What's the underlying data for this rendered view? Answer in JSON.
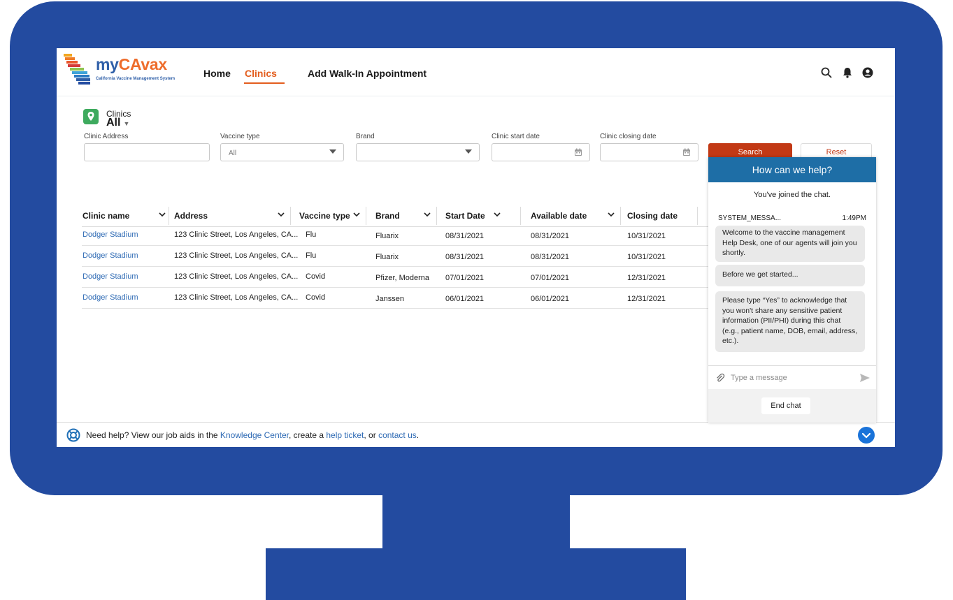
{
  "app": {
    "brand_prefix": "my",
    "brand_accent": "CAvax",
    "brand_subtitle": "California Vaccine Management System"
  },
  "nav": {
    "items": [
      {
        "label": "Home"
      },
      {
        "label": "Clinics",
        "active": true
      },
      {
        "label": "Add Walk-In Appointment"
      }
    ],
    "icons": [
      "search-icon",
      "bell-icon",
      "user-icon"
    ]
  },
  "page": {
    "object_label": "Clinics",
    "list_view": "All"
  },
  "filters": {
    "clinic_address": {
      "label": "Clinic Address",
      "value": ""
    },
    "vaccine_type": {
      "label": "Vaccine type",
      "value": "All"
    },
    "brand": {
      "label": "Brand",
      "value": ""
    },
    "start_date": {
      "label": "Clinic start date",
      "value": ""
    },
    "closing_date": {
      "label": "Clinic closing date",
      "value": ""
    },
    "search_label": "Search",
    "reset_label": "Reset"
  },
  "table": {
    "columns": [
      "Clinic name",
      "Address",
      "Vaccine type",
      "Brand",
      "Start Date",
      "Available date",
      "Closing date"
    ],
    "rows": [
      {
        "name": "Dodger Stadium",
        "address": "123 Clinic Street, Los Angeles, CA...",
        "vaccine": "Flu",
        "brand": "Fluarix",
        "start": "08/31/2021",
        "available": "08/31/2021",
        "closing": "10/31/2021"
      },
      {
        "name": "Dodger Stadium",
        "address": "123 Clinic Street, Los Angeles, CA...",
        "vaccine": "Flu",
        "brand": "Fluarix",
        "start": "08/31/2021",
        "available": "08/31/2021",
        "closing": "10/31/2021"
      },
      {
        "name": "Dodger Stadium",
        "address": "123 Clinic Street, Los Angeles, CA...",
        "vaccine": "Covid",
        "brand": "Pfizer, Moderna",
        "start": "07/01/2021",
        "available": "07/01/2021",
        "closing": "12/31/2021"
      },
      {
        "name": "Dodger Stadium",
        "address": "123 Clinic Street, Los Angeles, CA...",
        "vaccine": "Covid",
        "brand": "Janssen",
        "start": "06/01/2021",
        "available": "06/01/2021",
        "closing": "12/31/2021"
      }
    ]
  },
  "chat": {
    "title": "How can we help?",
    "joined": "You've joined the chat.",
    "sender": "SYSTEM_MESSA...",
    "time": "1:49PM",
    "messages": [
      "Welcome to the vaccine management  Help Desk, one of our agents will join you shortly.",
      "Before we get started...",
      " Please type “Yes” to acknowledge that you won't share any sensitive patient information (PII/PHI) during this chat (e.g., patient name, DOB, email, address, etc.)."
    ],
    "input_placeholder": "Type a message",
    "end_label": "End chat"
  },
  "help": {
    "prefix": "Need help? View our job aids in the ",
    "link1": "Knowledge Center",
    "mid1": ", create a ",
    "link2": "help ticket",
    "mid2": ", or ",
    "link3": "contact us",
    "suffix": "."
  },
  "colors": {
    "frame": "#234ba0",
    "accent": "#e35d1d",
    "link": "#2e6ab4",
    "chat_header": "#1e6ea6",
    "search_button": "#c23915"
  }
}
